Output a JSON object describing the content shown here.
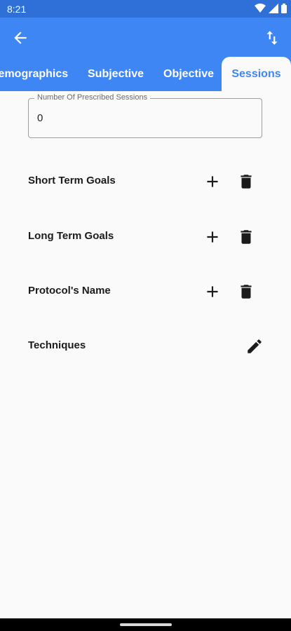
{
  "status_bar": {
    "time": "8:21",
    "icons": [
      "wifi-icon",
      "signal-icon",
      "battery-icon"
    ]
  },
  "app_bar": {
    "back_icon": "arrow-left-icon",
    "action_icon": "swap-vert-icon",
    "tabs": [
      {
        "label": "Demographics"
      },
      {
        "label": "Subjective"
      },
      {
        "label": "Objective"
      },
      {
        "label": "Sessions"
      }
    ],
    "active_tab": "Sessions"
  },
  "sessions_field": {
    "label": "Number Of Prescribed Sessions",
    "value": "0"
  },
  "sections": [
    {
      "label": "Short Term Goals",
      "icons": [
        "plus-icon",
        "trash-icon"
      ]
    },
    {
      "label": "Long Term Goals",
      "icons": [
        "plus-icon",
        "trash-icon"
      ]
    },
    {
      "label": "Protocol's Name",
      "icons": [
        "plus-icon",
        "trash-icon"
      ]
    },
    {
      "label": "Techniques",
      "icons": [
        "pencil-icon"
      ]
    }
  ],
  "colors": {
    "primary": "#3f86f5",
    "status_bar": "#2e6fd8",
    "background": "#fafafa",
    "text": "#1b1b1b"
  }
}
